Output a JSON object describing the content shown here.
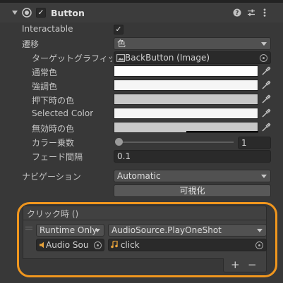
{
  "component": {
    "title": "Button",
    "header_icons": [
      "help-icon",
      "settings-sliders-icon",
      "more-vertical-icon"
    ]
  },
  "properties": {
    "interactable_label": "Interactable",
    "transition_label": "遷移",
    "transition_value": "色",
    "target_graphic_label": "ターゲットグラフィッ",
    "target_graphic_value": "BackButton (Image)",
    "normal_color_label": "通常色",
    "highlighted_color_label": "強調色",
    "pressed_color_label": "押下時の色",
    "selected_color_label": "Selected Color",
    "disabled_color_label": "無効時の色",
    "color_multiplier_label": "カラー乗数",
    "color_multiplier_value": "1",
    "color_multiplier_slider": 0.0,
    "fade_duration_label": "フェード間隔",
    "fade_duration_value": "0.1",
    "navigation_label": "ナビゲーション",
    "navigation_value": "Automatic",
    "visualize_label": "可視化"
  },
  "colors": {
    "normal": "#ffffff",
    "highlighted": "#f5f5f5",
    "pressed": "#c8c8c8",
    "selected": "#f5f5f5",
    "disabled": "#c8c8c8",
    "highlight_outline": "#f0961e"
  },
  "on_click": {
    "header": "クリック時 ()",
    "runtime_value": "Runtime Only",
    "function_value": "AudioSource.PlayOneShot",
    "object_value": "Audio Sou",
    "argument_value": "click",
    "add_label": "+",
    "remove_label": "−"
  }
}
